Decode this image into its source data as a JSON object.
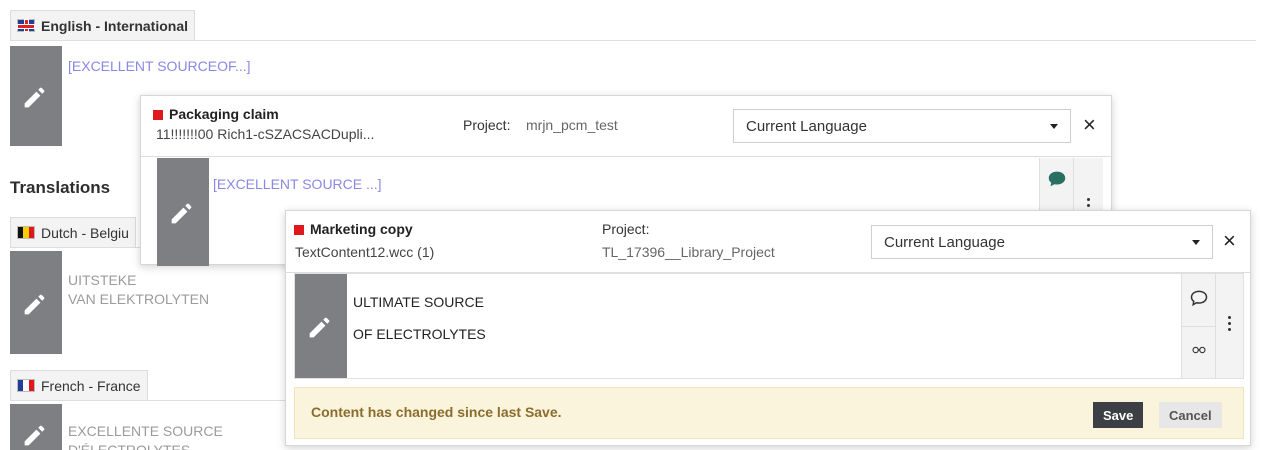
{
  "languages": {
    "english": {
      "label": "English - International",
      "content": "[EXCELLENT SOURCEOF...]"
    },
    "dutch": {
      "label": "Dutch - Belgiu",
      "content_line1": "UITSTEKE",
      "content_line2": "VAN ELEKTROLYTEN"
    },
    "french": {
      "label": "French - France",
      "content_line1": "EXCELLENTE SOURCE",
      "content_line2": "D'ÉLECTROLYTES"
    }
  },
  "translations_heading": "Translations",
  "panel_packaging": {
    "claim_type": "Packaging claim",
    "claim_id": "11!!!!!!!00 Rich1-cSZACSACDupli...",
    "project_label": "Project:",
    "project_value": "mrjn_pcm_test",
    "language_select": "Current Language",
    "content": "[EXCELLENT SOURCE ...]"
  },
  "panel_marketing": {
    "claim_type": "Marketing copy",
    "claim_id": "TextContent12.wcc (1)",
    "project_label": "Project:",
    "project_value": "TL_17396__Library_Project",
    "language_select": "Current Language",
    "content_line1": "ULTIMATE SOURCE",
    "content_line2": "OF ELECTROLYTES",
    "notice": "Content has changed since last Save.",
    "save_label": "Save",
    "cancel_label": "Cancel"
  },
  "icons": {
    "close": "×",
    "flag_colors": {
      "belgium": [
        "#111111",
        "#f5d000",
        "#e0181b"
      ],
      "france": [
        "#1f3f9a",
        "#ffffff",
        "#e0181b"
      ]
    },
    "brand_red": "#e0181b",
    "tile_grey": "#7d7f82"
  }
}
